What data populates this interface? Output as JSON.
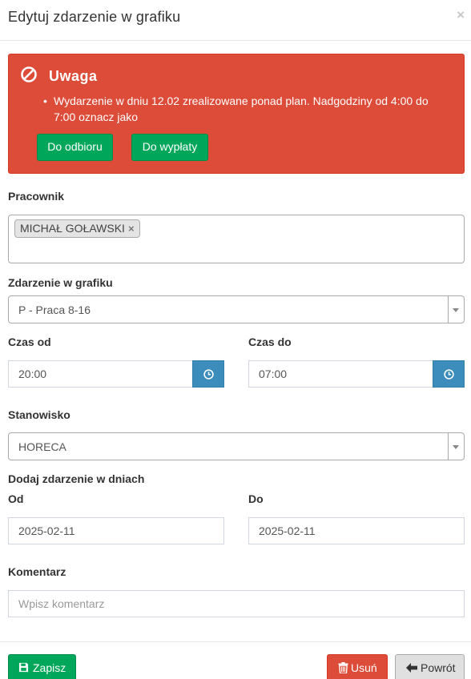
{
  "modal": {
    "title": "Edytuj zdarzenie w grafiku",
    "close": "×"
  },
  "alert": {
    "title": "Uwaga",
    "message": "Wydarzenie w dniu 12.02 zrealizowane ponad plan. Nadgodziny od 4:00 do 7:00 oznacz jako",
    "btn_odbior": "Do odbioru",
    "btn_wyplata": "Do wypłaty"
  },
  "employee": {
    "label": "Pracownik",
    "tag": "MICHAŁ GOŁAWSKI",
    "tag_remove": "×"
  },
  "event": {
    "label": "Zdarzenie w grafiku",
    "value": "P - Praca 8-16"
  },
  "time": {
    "from_label": "Czas od",
    "from_value": "20:00",
    "to_label": "Czas do",
    "to_value": "07:00"
  },
  "position": {
    "label": "Stanowisko",
    "value": "HORECA"
  },
  "days": {
    "section_label": "Dodaj zdarzenie w dniach",
    "from_label": "Od",
    "from_value": "2025-02-11",
    "to_label": "Do",
    "to_value": "2025-02-11"
  },
  "comment": {
    "label": "Komentarz",
    "placeholder": "Wpisz komentarz"
  },
  "footer": {
    "save": "Zapisz",
    "delete": "Usuń",
    "back": "Powrót"
  },
  "colors": {
    "danger": "#dd4b39",
    "success": "#00a65a",
    "primary": "#3c8dbc"
  },
  "icons": [
    "ban-icon",
    "clock-icon",
    "save-icon",
    "trash-icon",
    "arrow-left-icon",
    "chevron-down-icon",
    "close-icon"
  ]
}
